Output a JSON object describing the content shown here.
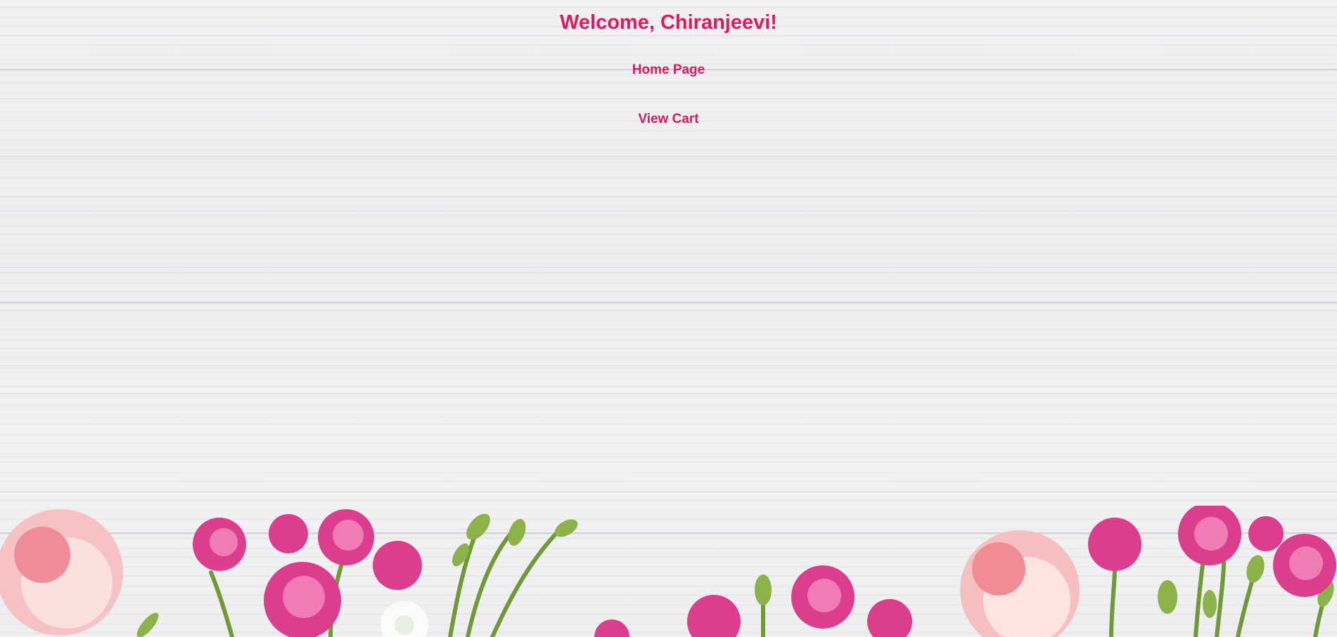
{
  "header": {
    "welcome_text": "Welcome, Chiranjeevi!"
  },
  "nav": {
    "home_label": "Home Page",
    "cart_label": "View Cart"
  },
  "theme": {
    "accent": "#e0195f",
    "background": "#f1f0f1",
    "flower_pink": "#e0408a",
    "flower_peach": "#f4b6b6",
    "leaf_green": "#7aa33a"
  },
  "decoration": {
    "background_image": "white-wood-planks-with-pink-roses"
  }
}
